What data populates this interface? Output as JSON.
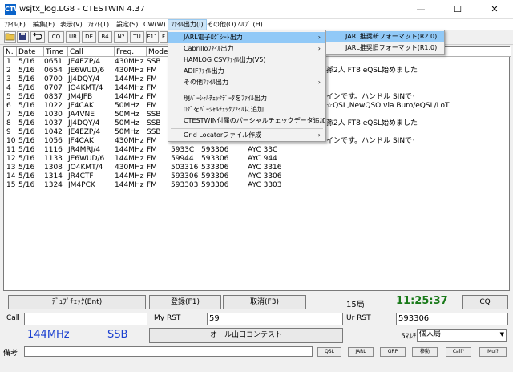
{
  "window": {
    "title": "wsjtx_log.LG8 - CTESTWIN  4.37",
    "icon_text": "CTW",
    "minimize": "—",
    "maximize": "☐",
    "close": "✕"
  },
  "menu": [
    "ﾌｧｲﾙ(F)",
    "編集(E)",
    "表示(V)",
    "ﾌｫﾝﾄ(T)",
    "設定(S)",
    "CW(W)",
    "ﾌｧｲﾙ出力(I)",
    "その他(O)",
    "ﾍﾙﾌﾟ (H)"
  ],
  "toolbar": [
    "CQ",
    "UR",
    "DE",
    "B4",
    "N?",
    "TU",
    "F11",
    "F"
  ],
  "table": {
    "headers": [
      "N.",
      "Date",
      "Time",
      "Call",
      "Freq.",
      "Mode"
    ],
    "rows": [
      {
        "n": "1",
        "date": "5/16",
        "time": "0651",
        "call": "JE4EZP/4",
        "freq": "430MHz",
        "mode": "SSB",
        "rst": "",
        "rcv": "",
        "mult": ""
      },
      {
        "n": "2",
        "date": "5/16",
        "time": "0654",
        "call": "JE6WUD/6",
        "freq": "430MHz",
        "mode": "FM",
        "rst": "",
        "rcv": "",
        "mult": ""
      },
      {
        "n": "3",
        "date": "5/16",
        "time": "0700",
        "call": "JJ4DQY/4",
        "freq": "144MHz",
        "mode": "FM",
        "rst": "",
        "rcv": "",
        "mult": ""
      },
      {
        "n": "4",
        "date": "5/16",
        "time": "0707",
        "call": "JO4KMT/4",
        "freq": "144MHz",
        "mode": "FM",
        "rst": "",
        "rcv": "",
        "mult": ""
      },
      {
        "n": "5",
        "date": "5/16",
        "time": "0837",
        "call": "JM4JFB",
        "freq": "144MHz",
        "mode": "FM",
        "rst": "",
        "rcv": "",
        "mult": ""
      },
      {
        "n": "6",
        "date": "5/16",
        "time": "1022",
        "call": "JF4CAK",
        "freq": "50MHz",
        "mode": "FM",
        "rst": "",
        "rcv": "",
        "mult": ""
      },
      {
        "n": "7",
        "date": "5/16",
        "time": "1030",
        "call": "JA4VNE",
        "freq": "50MHz",
        "mode": "SSB",
        "rst": "",
        "rcv": "",
        "mult": ""
      },
      {
        "n": "8",
        "date": "5/16",
        "time": "1037",
        "call": "JJ4DQY/4",
        "freq": "50MHz",
        "mode": "SSB",
        "rst": "",
        "rcv": "",
        "mult": ""
      },
      {
        "n": "9",
        "date": "5/16",
        "time": "1042",
        "call": "JE4EZP/4",
        "freq": "50MHz",
        "mode": "SSB",
        "rst": "",
        "rcv": "",
        "mult": ""
      },
      {
        "n": "10",
        "date": "5/16",
        "time": "1056",
        "call": "JF4CAK",
        "freq": "430MHz",
        "mode": "FM",
        "rst": "",
        "rcv": "",
        "mult": ""
      },
      {
        "n": "11",
        "date": "5/16",
        "time": "1116",
        "call": "JR4MRJ/4",
        "freq": "144MHz",
        "mode": "FM",
        "rst": "5933C",
        "rcv": "593306",
        "mult": "AYC 33C"
      },
      {
        "n": "12",
        "date": "5/16",
        "time": "1133",
        "call": "JE6WUD/6",
        "freq": "144MHz",
        "mode": "FM",
        "rst": "59944",
        "rcv": "593306",
        "mult": "AYC 944"
      },
      {
        "n": "13",
        "date": "5/16",
        "time": "1308",
        "call": "JO4KMT/4",
        "freq": "430MHz",
        "mode": "FM",
        "rst": "503316",
        "rcv": "533306",
        "mult": "AYC 3316"
      },
      {
        "n": "14",
        "date": "5/16",
        "time": "1314",
        "call": "JR4CTF",
        "freq": "144MHz",
        "mode": "FM",
        "rst": "593306",
        "rcv": "593306",
        "mult": "AYC 3306"
      },
      {
        "n": "15",
        "date": "5/16",
        "time": "1324",
        "call": "JM4PCK",
        "freq": "144MHz",
        "mode": "FM",
        "rst": "593303",
        "rcv": "593306",
        "mult": "AYC 3303"
      }
    ],
    "remarks": [
      {
        "row": 2,
        "text": "孫2人 FT8 eQSL始めました"
      },
      {
        "row": 5,
        "text": "インです。ハンドル  SINで･"
      },
      {
        "row": 6,
        "text": "☆QSL,NewQSO via Buro/eQSL/LoT"
      },
      {
        "row": 8,
        "text": "孫2人 FT8 eQSL始めました"
      },
      {
        "row": 10,
        "text": "インです。ハンドル  SINで･"
      }
    ]
  },
  "file_output_menu": {
    "items": [
      {
        "label": "JARL電子ﾛｸﾞｼｰﾄ出力",
        "submenu": true,
        "highlight": true
      },
      {
        "label": "Cabrilloﾌｧｲﾙ出力",
        "submenu": true
      },
      {
        "label": "HAMLOG CSVﾌｧｲﾙ出力(V5)",
        "submenu": false
      },
      {
        "label": "ADIFﾌｧｲﾙ出力",
        "submenu": false
      },
      {
        "label": "その他ﾌｧｲﾙ出力",
        "submenu": true
      },
      {
        "label": "現ﾊﾟｰｼｬﾙﾁｪｯｸﾃﾞｰﾀをﾌｧｲﾙ出力",
        "submenu": false
      },
      {
        "label": "ﾛｸﾞをﾊﾟｰｼｬﾙﾁｪｯｸﾌｧｲﾙに追加",
        "submenu": false
      },
      {
        "label": "CTESTWIN付属のパーシャルチェックデータ追加",
        "submenu": false
      },
      {
        "label": "Grid Locatorファイル作成",
        "submenu": true
      }
    ],
    "submenu": [
      {
        "label": "JARL推奨新フォーマット(R2.0)",
        "highlight": true
      },
      {
        "label": "JARL推奨旧フォーマット(R1.0)",
        "highlight": false
      }
    ]
  },
  "bottom": {
    "dupe_button": "ﾃﾞｭﾌﾟﾁｪｯｸ(Ent)",
    "register_button": "登録(F1)",
    "cancel_button": "取消(F3)",
    "qso_count": "15局",
    "clock": "11:25:37",
    "cq_button": "CQ",
    "call_label": "Call",
    "call_value": "",
    "myrst_label": "My RST",
    "myrst_value": "59",
    "urrst_label": "Ur RST",
    "urrst_value": "593306",
    "band": "144MHz",
    "mode": "SSB",
    "contest": "オール山口コンテスト",
    "multi_label": "ﾏﾙﾁ",
    "multi_count": "5",
    "category": "個人局",
    "remark_label": "備考",
    "remark_value": "",
    "small_buttons": [
      "QSL",
      "JARL",
      "GRP",
      "移動",
      "Call?",
      "Mul?"
    ],
    "clock_color": "#1a7a1a",
    "band_color": "#1a3fd0"
  }
}
